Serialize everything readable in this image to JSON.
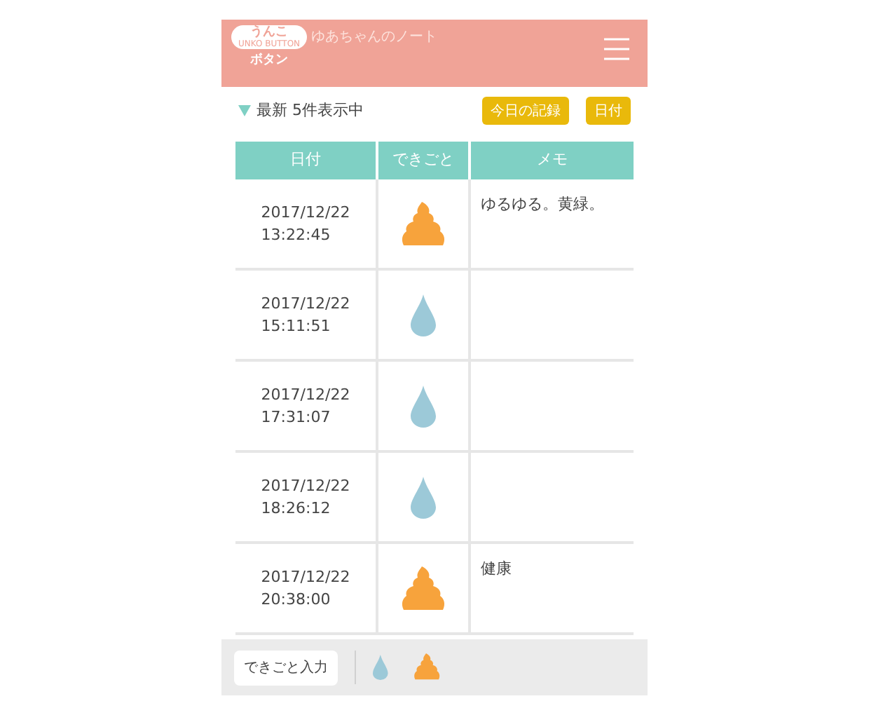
{
  "header": {
    "logo_top": "うんこ",
    "logo_small": "UNKO BUTTON",
    "logo_bottom": "ボタン",
    "title": "ゆあちゃんのノート"
  },
  "toolbar": {
    "filter": "最新 5件表示中",
    "expanded": true,
    "buttons": [
      "今日の記録",
      "日付"
    ]
  },
  "table": {
    "columns": [
      "日付",
      "できごと",
      "メモ"
    ],
    "rows": [
      {
        "date": "2017/12/22",
        "time": "13:22:45",
        "kind": "poop",
        "memo": "ゆるゆる。黄緑。"
      },
      {
        "date": "2017/12/22",
        "time": "15:11:51",
        "kind": "pee"
      },
      {
        "date": "2017/12/22",
        "time": "17:31:07",
        "kind": "pee"
      },
      {
        "date": "2017/12/22",
        "time": "18:26:12",
        "kind": "pee"
      },
      {
        "date": "2017/12/22",
        "time": "20:38:00",
        "kind": "poop",
        "memo": "健康"
      }
    ]
  },
  "footer": {
    "input_button": "できごと入力",
    "quick": [
      {
        "kind": "pee"
      },
      {
        "kind": "poop"
      }
    ]
  }
}
